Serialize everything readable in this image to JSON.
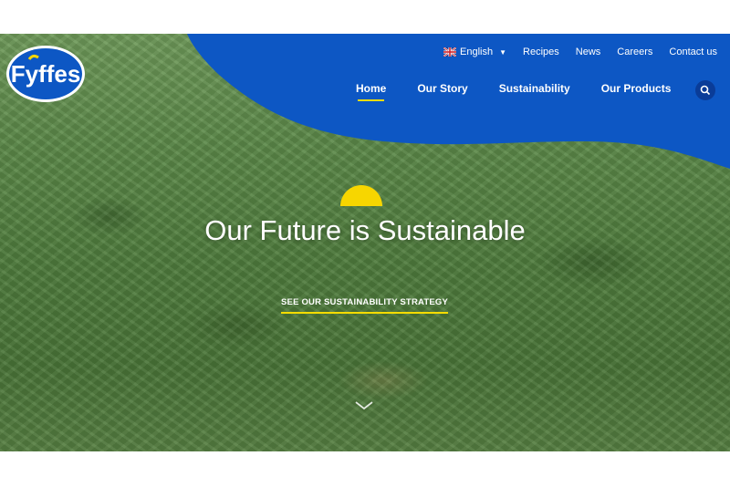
{
  "brand": {
    "name": "Fyffes",
    "color": "#0d57c4",
    "accent": "#f7d600"
  },
  "top_nav": {
    "language": "English",
    "language_flag": "uk-flag-icon",
    "links": [
      "Recipes",
      "News",
      "Careers",
      "Contact us"
    ]
  },
  "main_nav": {
    "items": [
      "Home",
      "Our Story",
      "Sustainability",
      "Our Products"
    ],
    "active": "Home",
    "search_icon": "search-icon"
  },
  "hero": {
    "headline": "Our Future is Sustainable",
    "cta": "SEE OUR SUSTAINABILITY STRATEGY",
    "scroll_icon": "chevron-down-icon"
  }
}
